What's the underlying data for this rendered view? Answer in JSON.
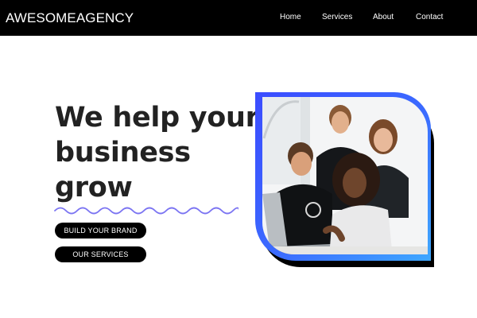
{
  "header": {
    "brand": "AWESOMEAGENCY",
    "nav": [
      {
        "label": "Home"
      },
      {
        "label": "Services"
      },
      {
        "label": "About"
      },
      {
        "label": "Contact"
      }
    ]
  },
  "hero": {
    "headline": [
      "We help your",
      "business",
      "grow"
    ],
    "buttons": [
      {
        "label": "BUILD YOUR BRAND"
      },
      {
        "label": "OUR SERVICES"
      }
    ]
  },
  "colors": {
    "header_bg": "#000000",
    "wave": "#7b74f2",
    "frame_gradient_start": "#3b5bff",
    "frame_gradient_end": "#3fa0ff",
    "button_bg": "#000000"
  }
}
